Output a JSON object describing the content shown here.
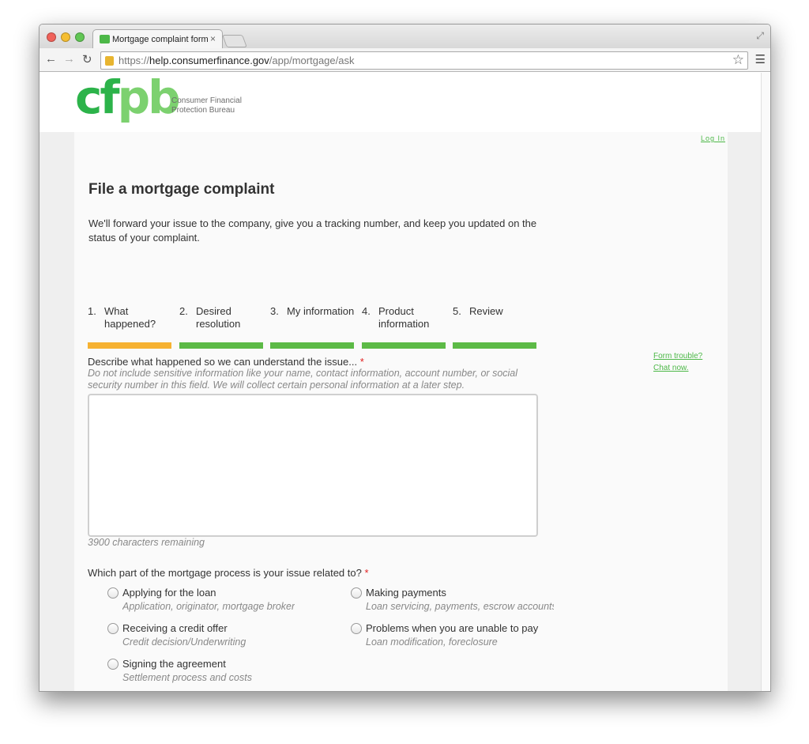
{
  "browser": {
    "tab_title": "Mortgage complaint form",
    "tab_close": "×",
    "url_scheme": "https://",
    "url_host": "help.consumerfinance.gov",
    "url_path": "/app/mortgage/ask"
  },
  "header": {
    "logo_text_dark": "cf",
    "logo_text_light": "pb",
    "logo_line1": "Consumer Financial",
    "logo_line2": "Protection Bureau",
    "login": "Log In"
  },
  "page": {
    "title": "File a mortgage complaint",
    "intro": "We'll forward your issue to the company, give you a tracking number, and keep you updated on the status of your complaint."
  },
  "steps": [
    {
      "num": "1.",
      "label": "What happened?",
      "status": "active"
    },
    {
      "num": "2.",
      "label": "Desired resolution",
      "status": "pending"
    },
    {
      "num": "3.",
      "label": "My information",
      "status": "pending"
    },
    {
      "num": "4.",
      "label": "Product information",
      "status": "pending"
    },
    {
      "num": "5.",
      "label": "Review",
      "status": "pending"
    }
  ],
  "question1": {
    "label": "Describe what happened so we can understand the issue...",
    "required_mark": "*",
    "help": "Do not include sensitive information like your name, contact information, account number, or social security number in this field. We will collect certain personal information at a later step.",
    "value": "",
    "chars_remaining": "3900 characters remaining"
  },
  "side_links": {
    "form_trouble": "Form trouble?",
    "chat": "Chat now."
  },
  "question2": {
    "label": "Which part of the mortgage process is your issue related to?",
    "required_mark": "*",
    "options": [
      {
        "label": "Applying for the loan",
        "sub": "Application, originator, mortgage broker"
      },
      {
        "label": "Making payments",
        "sub": "Loan servicing, payments, escrow accounts"
      },
      {
        "label": "Receiving a credit offer",
        "sub": "Credit decision/Underwriting"
      },
      {
        "label": "Problems when you are unable to pay",
        "sub": "Loan modification, foreclosure"
      },
      {
        "label": "Signing the agreement",
        "sub": "Settlement process and costs"
      }
    ]
  },
  "colors": {
    "brand_green": "#2cb34a",
    "step_done": "#5cba46",
    "step_active": "#f6b231",
    "required": "#e21f1f"
  }
}
